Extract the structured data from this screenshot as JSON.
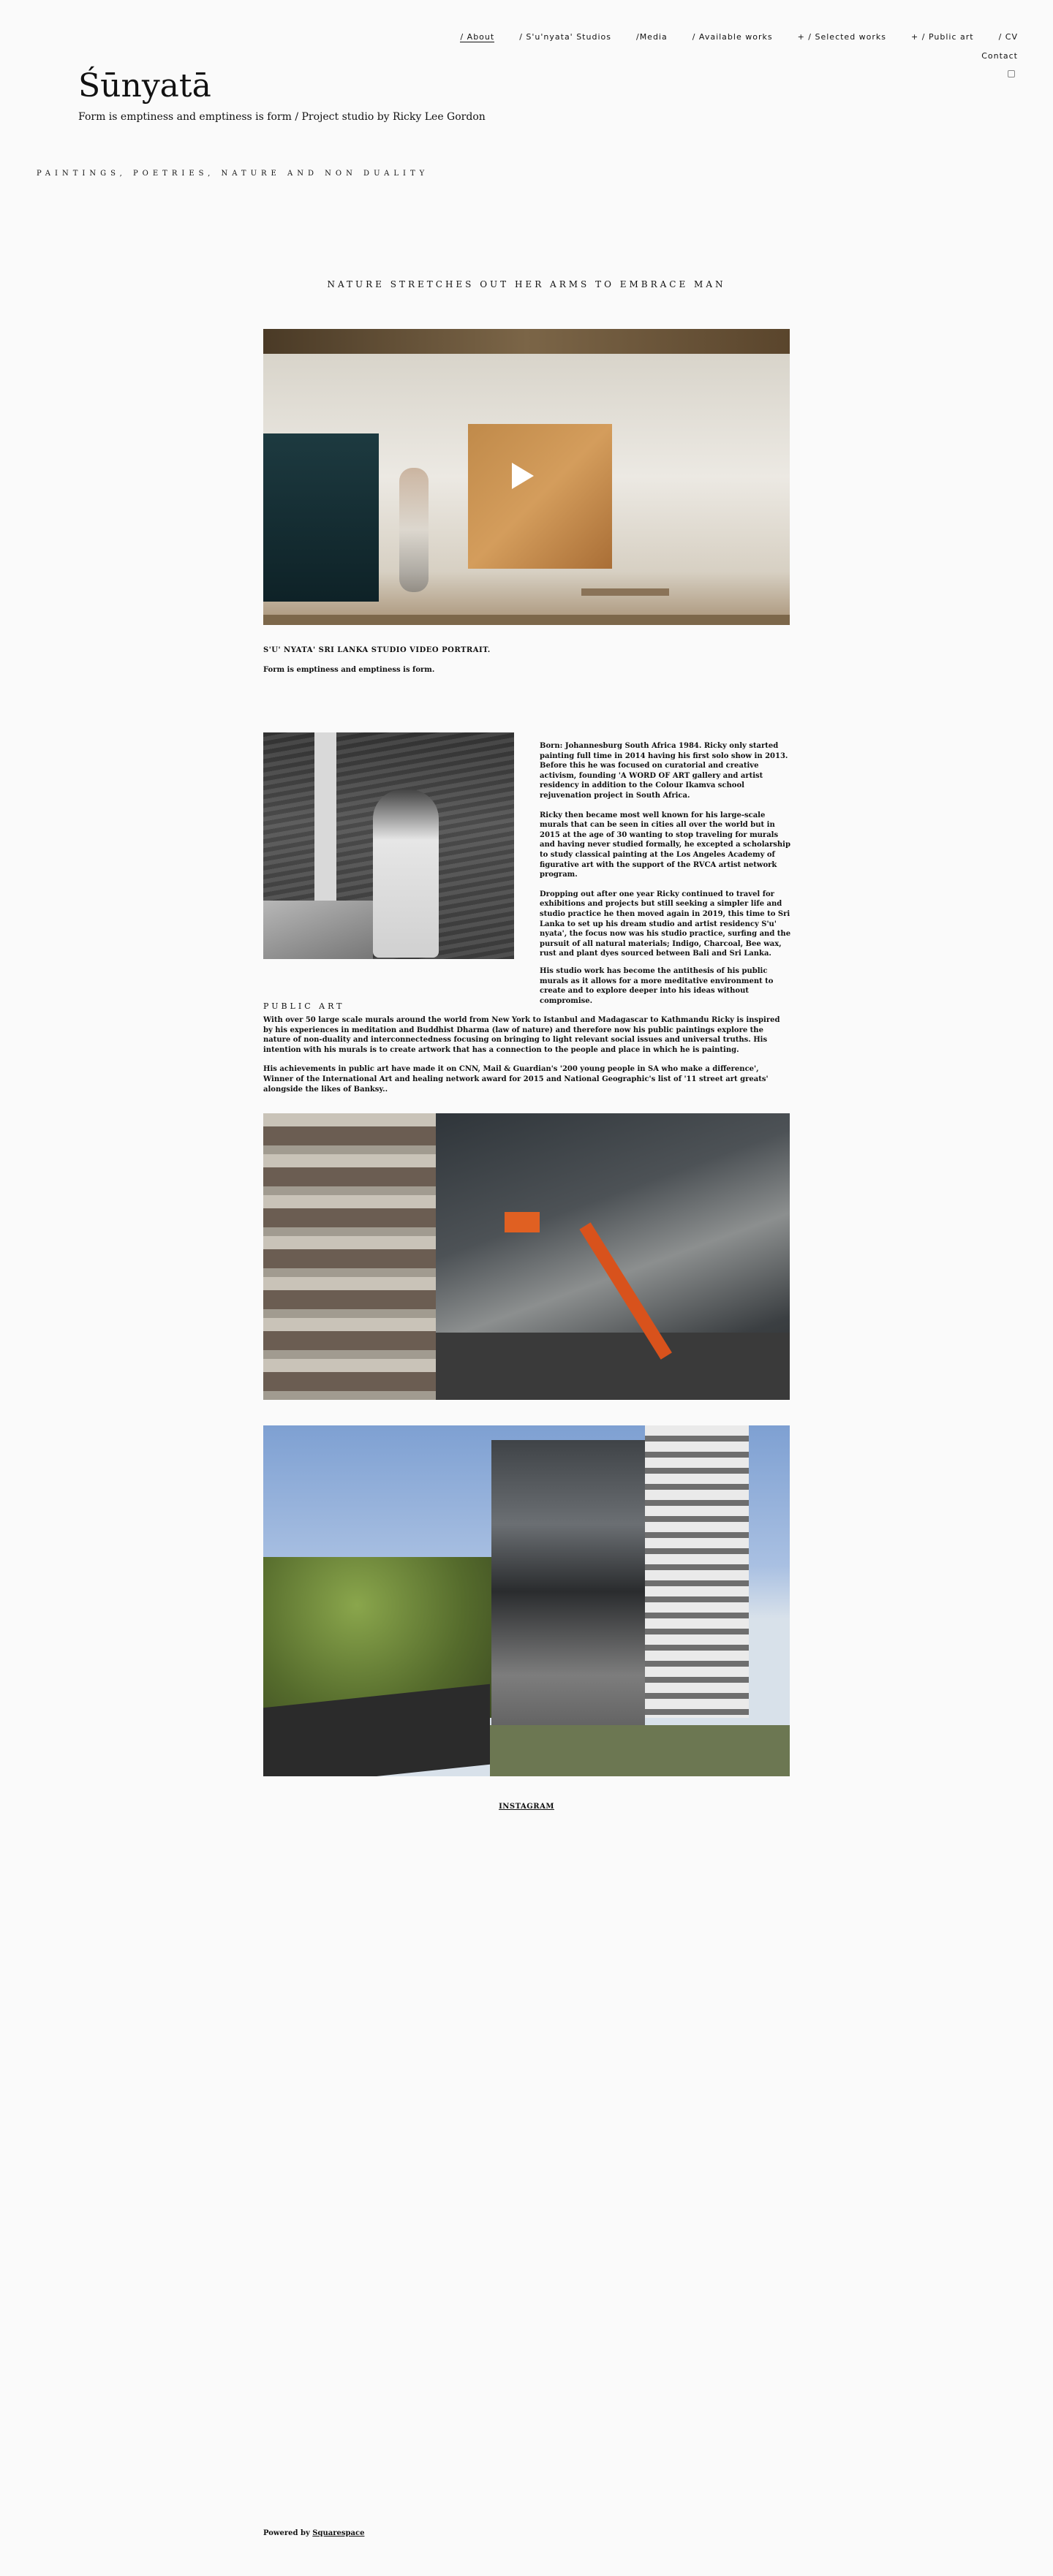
{
  "site": {
    "title": "Śūnyatā",
    "subtitle": "Form is emptiness and emptiness is form / Project studio by Ricky Lee Gordon",
    "tagline": "PAINTINGS, POETRIES, NATURE AND NON DUALITY"
  },
  "nav": {
    "items": [
      "/ About",
      "/ S'u'nyata' Studios",
      "/Media",
      "/ Available works",
      "+ / Selected works",
      "+ / Public art",
      "/ CV"
    ],
    "contact": "Contact",
    "instagram_icon": "instagram-icon"
  },
  "main": {
    "heading": "NATURE STRETCHES OUT HER ARMS TO EMBRACE MAN",
    "video_caption_title": "S'U' NYATA' SRI LANKA STUDIO VIDEO PORTRAIT.",
    "video_caption_text": "Form is emptiness and emptiness is form.",
    "bio": [
      "Born: Johannesburg South Africa 1984. Ricky only started painting full time in 2014 having his first solo show in 2013. Before this he was focused on curatorial and creative activism, founding 'A WORD OF ART gallery and artist residency in addition to the Colour Ikamva school rejuvenation project in South Africa.",
      "Ricky then became most well known for his large-scale murals that can be seen in cities all over the world but in 2015 at the age of 30 wanting to stop traveling for murals and having never studied formally,  he excepted a scholarship to study classical painting at the Los Angeles Academy of figurative art with the support of the RVCA artist network program.",
      "Dropping out after one year Ricky continued to travel for exhibitions and projects but still seeking a simpler life and studio practice he then moved again in 2019, this time to Sri Lanka to set up his dream studio and artist residency S'u' nyata', the focus now was his studio practice, surfing and the pursuit of all natural materials; Indigo, Charcoal, Bee wax, rust and plant dyes sourced between Bali and Sri Lanka."
    ],
    "bio_tail": "His studio work has become the antithesis of his public murals as it allows for a more meditative environment to create and  to explore deeper into his ideas without compromise.",
    "public_art_heading": "PUBLIC ART",
    "public_art": [
      "With over 50 large scale murals around the world from New York to Istanbul and Madagascar to Kathmandu Ricky is inspired by his experiences in meditation and Buddhist Dharma (law of nature) and therefore now his public paintings explore the nature of non-duality and interconnectedness focusing on bringing to light relevant social issues and universal truths. His intention with his murals is to create artwork that has a connection to the people and place in which he is painting.",
      "His achievements in public art have made it on CNN, Mail & Guardian's '200 young people in SA who make a difference', Winner of the International Art and healing network award for 2015 and National Geographic's list of '11 street art greats' alongside the likes of Banksy.."
    ],
    "instagram_link": "INSTAGRAM"
  },
  "footer": {
    "powered_prefix": "Powered by ",
    "powered_link": "Squarespace"
  }
}
